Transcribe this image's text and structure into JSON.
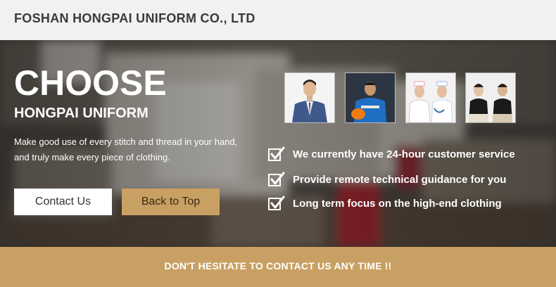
{
  "header": {
    "company_name": "FOSHAN HONGPAI UNIFORM CO., LTD"
  },
  "hero": {
    "title": "CHOOSE",
    "subtitle": "HONGPAI UNIFORM",
    "description_lines": [
      "Make good use of every stitch and thread in your hand,",
      "and truly make every piece of clothing."
    ],
    "buttons": {
      "contact": "Contact Us",
      "back_to_top": "Back to Top"
    },
    "thumbnails": [
      {
        "icon": "business-suit-uniform-icon"
      },
      {
        "icon": "workwear-uniform-icon"
      },
      {
        "icon": "nurse-uniform-icon"
      },
      {
        "icon": "polo-shirt-uniform-icon"
      }
    ],
    "features": [
      "We currently have 24-hour customer service",
      "Provide remote technical guidance for you",
      "Long term focus on the high-end clothing"
    ]
  },
  "footer": {
    "cta": "DON'T HESITATE TO CONTACT US ANY TIME !!"
  },
  "colors": {
    "accent": "#c9a063",
    "header_bg": "#f1f1f1",
    "hero_overlay": "#1e1c1a"
  }
}
